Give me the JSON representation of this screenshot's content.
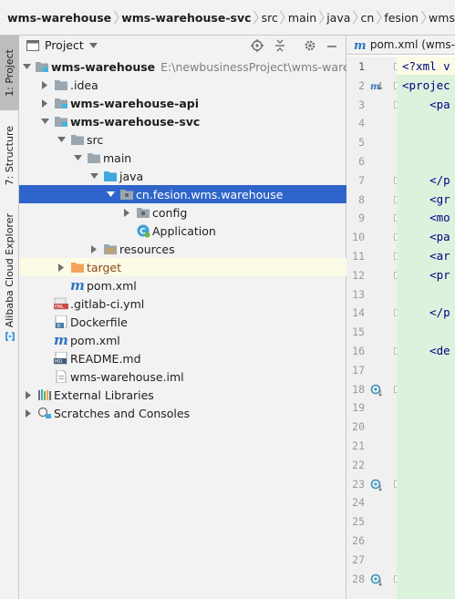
{
  "breadcrumb": [
    {
      "label": "wms-warehouse",
      "bold": true
    },
    {
      "label": "wms-warehouse-svc",
      "bold": true
    },
    {
      "label": "src",
      "bold": false
    },
    {
      "label": "main",
      "bold": false
    },
    {
      "label": "java",
      "bold": false
    },
    {
      "label": "cn",
      "bold": false
    },
    {
      "label": "fesion",
      "bold": false
    },
    {
      "label": "wms",
      "bold": false
    }
  ],
  "left_strip": {
    "project_tab": "1: Project",
    "structure_tab": "7: Structure",
    "alibaba_tab": "Alibaba Cloud Explorer"
  },
  "panel": {
    "title": "Project"
  },
  "tree": [
    {
      "depth": 0,
      "arrow": "down",
      "icon": "module-folder",
      "label": "wms-warehouse",
      "bold": true,
      "path": "E:\\newbusinessProject\\wms-warehou"
    },
    {
      "depth": 1,
      "arrow": "right",
      "icon": "folder",
      "label": ".idea"
    },
    {
      "depth": 1,
      "arrow": "right",
      "icon": "module-folder",
      "label": "wms-warehouse-api",
      "bold": true
    },
    {
      "depth": 1,
      "arrow": "down",
      "icon": "module-folder",
      "label": "wms-warehouse-svc",
      "bold": true
    },
    {
      "depth": 2,
      "arrow": "down",
      "icon": "folder",
      "label": "src"
    },
    {
      "depth": 3,
      "arrow": "down",
      "icon": "folder",
      "label": "main"
    },
    {
      "depth": 4,
      "arrow": "down",
      "icon": "source-folder",
      "label": "java"
    },
    {
      "depth": 5,
      "arrow": "down",
      "icon": "package",
      "label": "cn.fesion.wms.warehouse",
      "selected": true
    },
    {
      "depth": 6,
      "arrow": "right",
      "icon": "package",
      "label": "config"
    },
    {
      "depth": 6,
      "arrow": "none",
      "icon": "spring-class",
      "label": "Application"
    },
    {
      "depth": 4,
      "arrow": "right",
      "icon": "resources-folder",
      "label": "resources"
    },
    {
      "depth": 2,
      "arrow": "right",
      "icon": "excluded-folder",
      "label": "target",
      "highlight": true
    },
    {
      "depth": 2,
      "arrow": "none",
      "icon": "maven-file",
      "label": "pom.xml"
    },
    {
      "depth": 1,
      "arrow": "none",
      "icon": "yml-file",
      "label": ".gitlab-ci.yml"
    },
    {
      "depth": 1,
      "arrow": "none",
      "icon": "docker-file",
      "label": "Dockerfile"
    },
    {
      "depth": 1,
      "arrow": "none",
      "icon": "maven-file",
      "label": "pom.xml"
    },
    {
      "depth": 1,
      "arrow": "none",
      "icon": "md-file",
      "label": "README.md"
    },
    {
      "depth": 1,
      "arrow": "none",
      "icon": "iml-file",
      "label": "wms-warehouse.iml"
    },
    {
      "depth": 0,
      "arrow": "right",
      "icon": "libraries",
      "label": "External Libraries"
    },
    {
      "depth": 0,
      "arrow": "right",
      "icon": "scratches",
      "label": "Scratches and Consoles"
    }
  ],
  "editor": {
    "tab_label": "pom.xml (wms-",
    "line_numbers": [
      "1",
      "2",
      "3",
      "4",
      "5",
      "6",
      "7",
      "8",
      "9",
      "10",
      "11",
      "12",
      "13",
      "14",
      "15",
      "16",
      "17",
      "18",
      "19",
      "20",
      "21",
      "22",
      "23",
      "24",
      "25",
      "26",
      "27",
      "28"
    ],
    "lines": [
      {
        "n": 1,
        "text": "<?xml v"
      },
      {
        "n": 2,
        "text": "<projec"
      },
      {
        "n": 3,
        "text": "    <pa"
      },
      {
        "n": 7,
        "text": "    </p"
      },
      {
        "n": 8,
        "text": "    <gr"
      },
      {
        "n": 9,
        "text": "    <mo"
      },
      {
        "n": 10,
        "text": "    <pa"
      },
      {
        "n": 11,
        "text": "    <ar"
      },
      {
        "n": 12,
        "text": "    <pr"
      },
      {
        "n": 14,
        "text": "    </p"
      },
      {
        "n": 16,
        "text": "    <de"
      }
    ]
  },
  "colors": {
    "selection": "#2f65ca",
    "editor_bg": "#ffffff",
    "code_added_bg": "#ddf2dd",
    "tag_color": "#000080"
  }
}
